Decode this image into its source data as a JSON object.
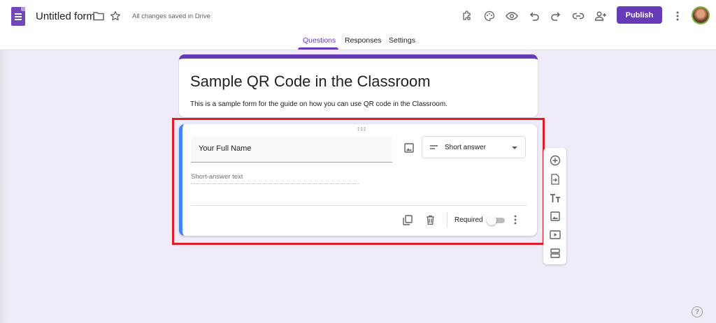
{
  "header": {
    "title": "Untitled form",
    "save_status": "All changes saved in Drive",
    "publish_label": "Publish"
  },
  "tabs": [
    {
      "label": "Questions",
      "active": true
    },
    {
      "label": "Responses",
      "active": false
    },
    {
      "label": "Settings",
      "active": false
    }
  ],
  "form": {
    "title": "Sample QR Code in the Classroom",
    "description": "This is a sample form for the guide on how you can use QR code in the Classroom."
  },
  "question": {
    "title": "Your Full Name",
    "type": "Short answer",
    "answer_placeholder": "Short-answer text",
    "required_label": "Required",
    "required": false
  },
  "side_toolbar": [
    "add-question-icon",
    "import-questions-icon",
    "add-title-icon",
    "add-image-icon",
    "add-video-icon",
    "add-section-icon"
  ],
  "help_label": "?",
  "colors": {
    "accent": "#673ab7",
    "background": "#f0ebf8",
    "active_question": "#4285f4",
    "highlight": "#e01e26"
  }
}
